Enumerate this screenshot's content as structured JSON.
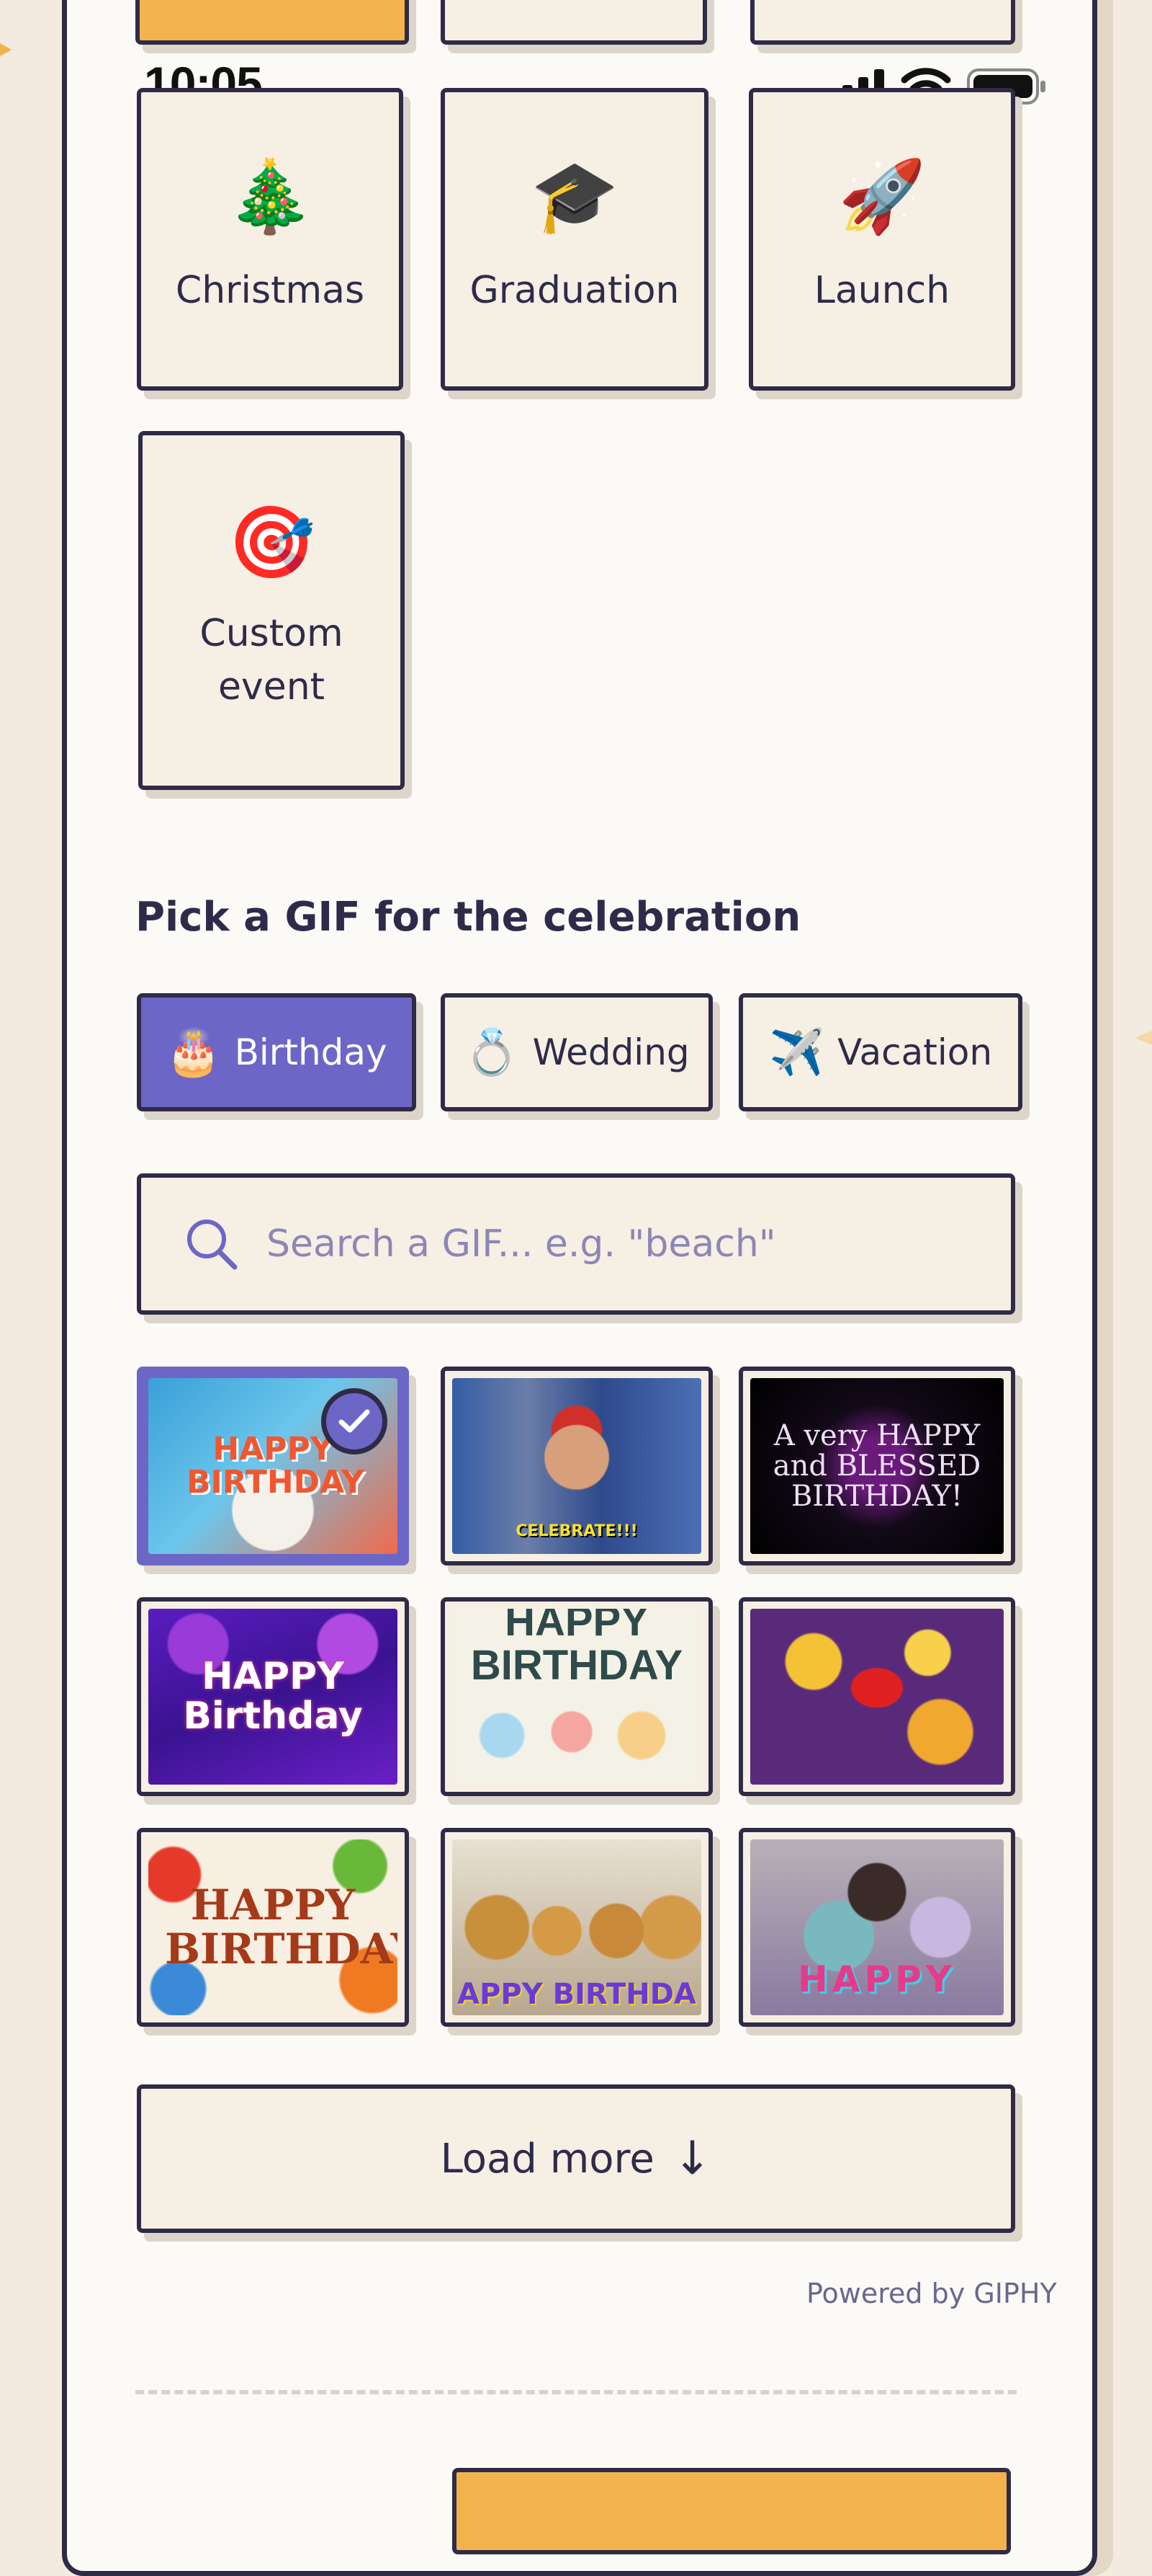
{
  "status_bar": {
    "time": "10:05"
  },
  "occasions": [
    {
      "emoji": "🎄",
      "icon_name": "christmas-tree-icon",
      "label": "Christmas"
    },
    {
      "emoji": "🎓",
      "icon_name": "graduation-cap-icon",
      "label": "Graduation"
    },
    {
      "emoji": "🚀",
      "icon_name": "rocket-icon",
      "label": "Launch"
    },
    {
      "emoji": "🎯",
      "icon_name": "target-icon",
      "label": "Custom event"
    }
  ],
  "gif_section": {
    "title": "Pick a GIF for the celebration",
    "chips": [
      {
        "emoji": "🎂",
        "icon_name": "birthday-cake-icon",
        "label": "Birthday",
        "active": true
      },
      {
        "emoji": "💍",
        "icon_name": "ring-icon",
        "label": "Wedding",
        "active": false
      },
      {
        "emoji": "✈️",
        "icon_name": "airplane-icon",
        "label": "Vacation",
        "active": false
      }
    ],
    "search": {
      "icon_name": "search-icon",
      "placeholder": "Search a GIF... e.g. \"beach\""
    },
    "gifs": [
      {
        "caption": "HAPPY BIRTHDAY",
        "selected": true
      },
      {
        "caption": "CELEBRATE!!!",
        "selected": false
      },
      {
        "caption": "A very HAPPY and BLESSED BIRTHDAY!",
        "selected": false
      },
      {
        "caption": "HAPPY Birthday",
        "selected": false
      },
      {
        "caption": "HAPPY BIRTHDAY",
        "selected": false
      },
      {
        "caption": "",
        "selected": false
      },
      {
        "caption": "HAPPY BIRTHDAY",
        "selected": false
      },
      {
        "caption": "APPY BIRTHDA",
        "selected": false
      },
      {
        "caption": "HAPPY",
        "selected": false
      }
    ],
    "load_more_label": "Load more",
    "load_more_icon": "↓",
    "powered_by": "Powered by GIPHY"
  },
  "colors": {
    "accent": "#6c67c6",
    "ink": "#2f2b47",
    "card_bg": "#f6efe4",
    "cta_orange": "#f3b24c"
  }
}
